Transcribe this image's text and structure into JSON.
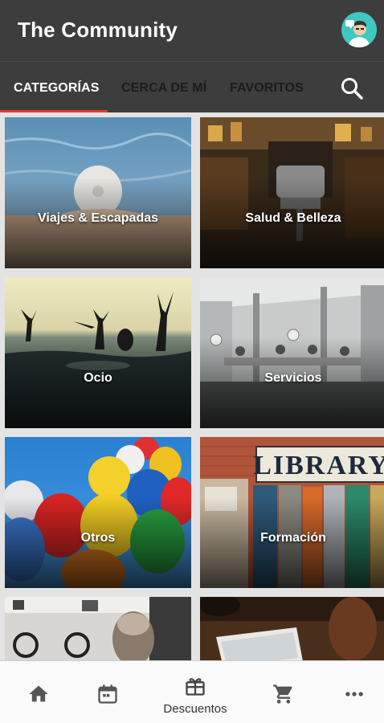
{
  "app": {
    "title": "The Community"
  },
  "tabs": [
    {
      "label": "CATEGORÍAS",
      "active": true
    },
    {
      "label": "CERCA DE MÍ",
      "active": false
    },
    {
      "label": "FAVORITOS",
      "active": false
    }
  ],
  "search_icon": "search-icon",
  "categories": [
    {
      "label": "Viajes & Escapadas"
    },
    {
      "label": "Salud & Belleza"
    },
    {
      "label": "Ocio"
    },
    {
      "label": "Servicios"
    },
    {
      "label": "Otros"
    },
    {
      "label": "Formación"
    },
    {
      "label": ""
    },
    {
      "label": ""
    }
  ],
  "library_sign": "LIBRARY",
  "bottom_nav": [
    {
      "icon": "home-icon",
      "label": ""
    },
    {
      "icon": "calendar-icon",
      "label": ""
    },
    {
      "icon": "gift-icon",
      "label": "Descuentos",
      "active": true
    },
    {
      "icon": "cart-icon",
      "label": ""
    },
    {
      "icon": "more-icon",
      "label": ""
    }
  ],
  "colors": {
    "app_bar": "#3d3d3d",
    "tab_indicator": "#e53935",
    "avatar_bg": "#3fc8c0",
    "bottom_nav_bg": "#fafafa"
  }
}
